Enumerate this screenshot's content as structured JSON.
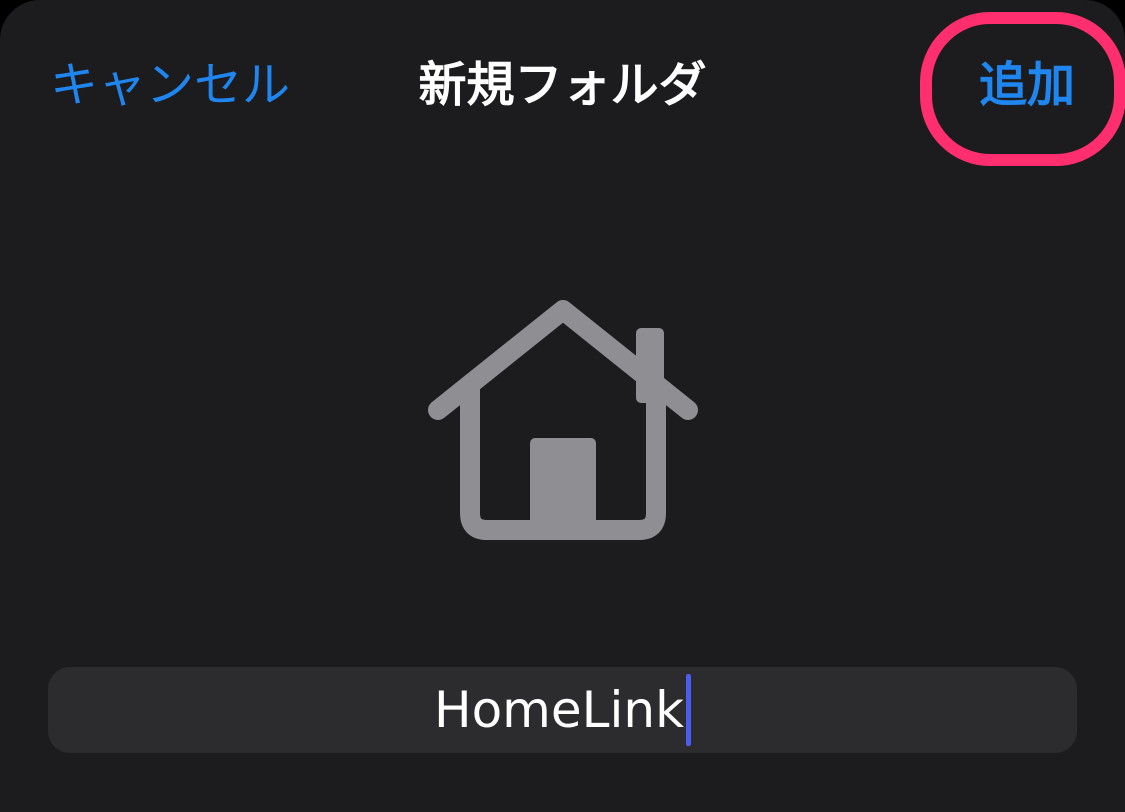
{
  "nav": {
    "cancel_label": "キャンセル",
    "title": "新規フォルダ",
    "add_label": "追加"
  },
  "folder": {
    "icon": "house-icon",
    "name_value": "HomeLink"
  },
  "colors": {
    "accent": "#1f86f0",
    "sheet_background": "#1c1c1e",
    "field_background": "#2c2c2e",
    "icon_gray": "#8e8e93",
    "highlight_ring": "#ff2e6e",
    "caret": "#4a5df0"
  }
}
